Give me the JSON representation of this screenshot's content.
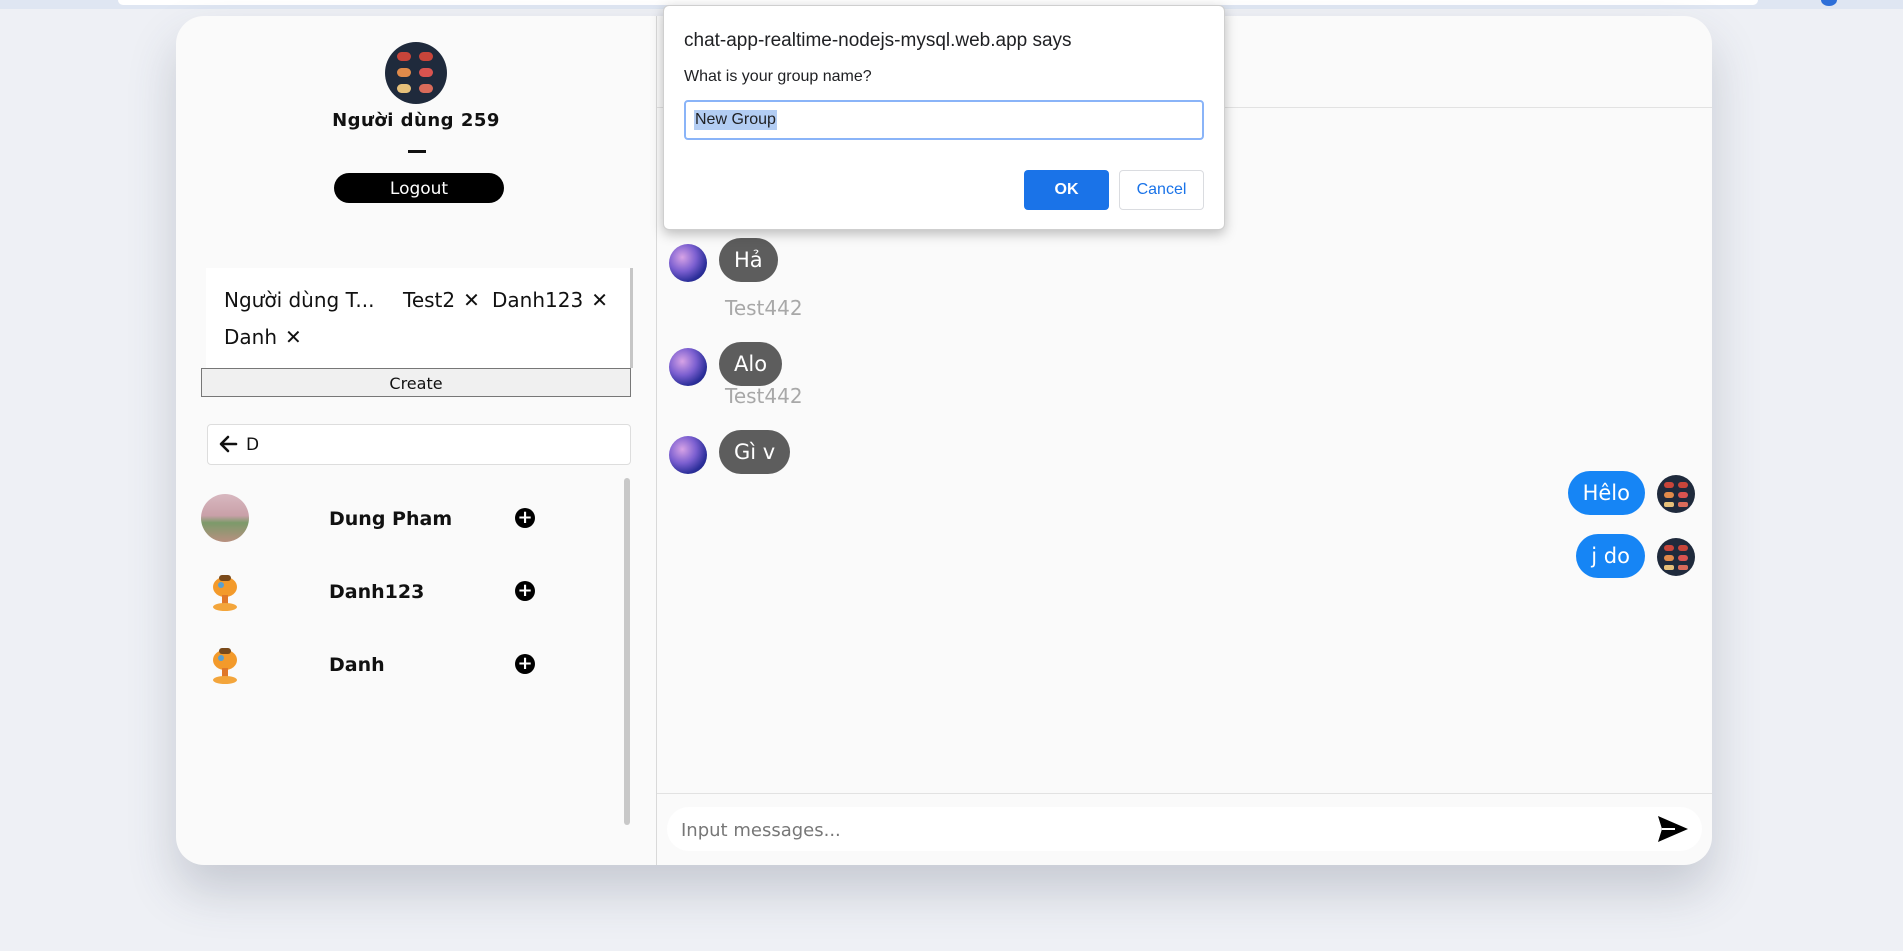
{
  "dialog": {
    "origin": "chat-app-realtime-nodejs-mysql.web.app says",
    "prompt": "What is your group name?",
    "value": "New Group",
    "ok_label": "OK",
    "cancel_label": "Cancel"
  },
  "profile": {
    "name": "Người dùng 259",
    "logout_label": "Logout"
  },
  "group_builder": {
    "selected": [
      {
        "label": "Người dùng T...",
        "removable": false
      },
      {
        "label": "Test2",
        "removable": true
      },
      {
        "label": "Danh123",
        "removable": true
      },
      {
        "label": "Danh",
        "removable": true
      }
    ],
    "remove_glyph": "✕",
    "create_label": "Create"
  },
  "search": {
    "value": "D",
    "back_icon": "arrow-left-icon"
  },
  "users": [
    {
      "name": "Dung Pham",
      "avatar": "landscape"
    },
    {
      "name": "Danh123",
      "avatar": "bird"
    },
    {
      "name": "Danh",
      "avatar": "bird"
    }
  ],
  "add_glyph": "+",
  "messages": {
    "incoming": [
      {
        "sender": "Test442",
        "text": "Hả"
      },
      {
        "sender": "Test442",
        "text": "Alo"
      },
      {
        "sender": "Test442",
        "text": "Gì v"
      }
    ],
    "outgoing": [
      {
        "text": "Hêlo"
      },
      {
        "text": "j do"
      }
    ]
  },
  "composer": {
    "placeholder": "Input messages..."
  },
  "colors": {
    "accent": "#1685f5",
    "incoming_bubble": "#5d5d5d",
    "dialog_ok": "#1a73e8"
  }
}
